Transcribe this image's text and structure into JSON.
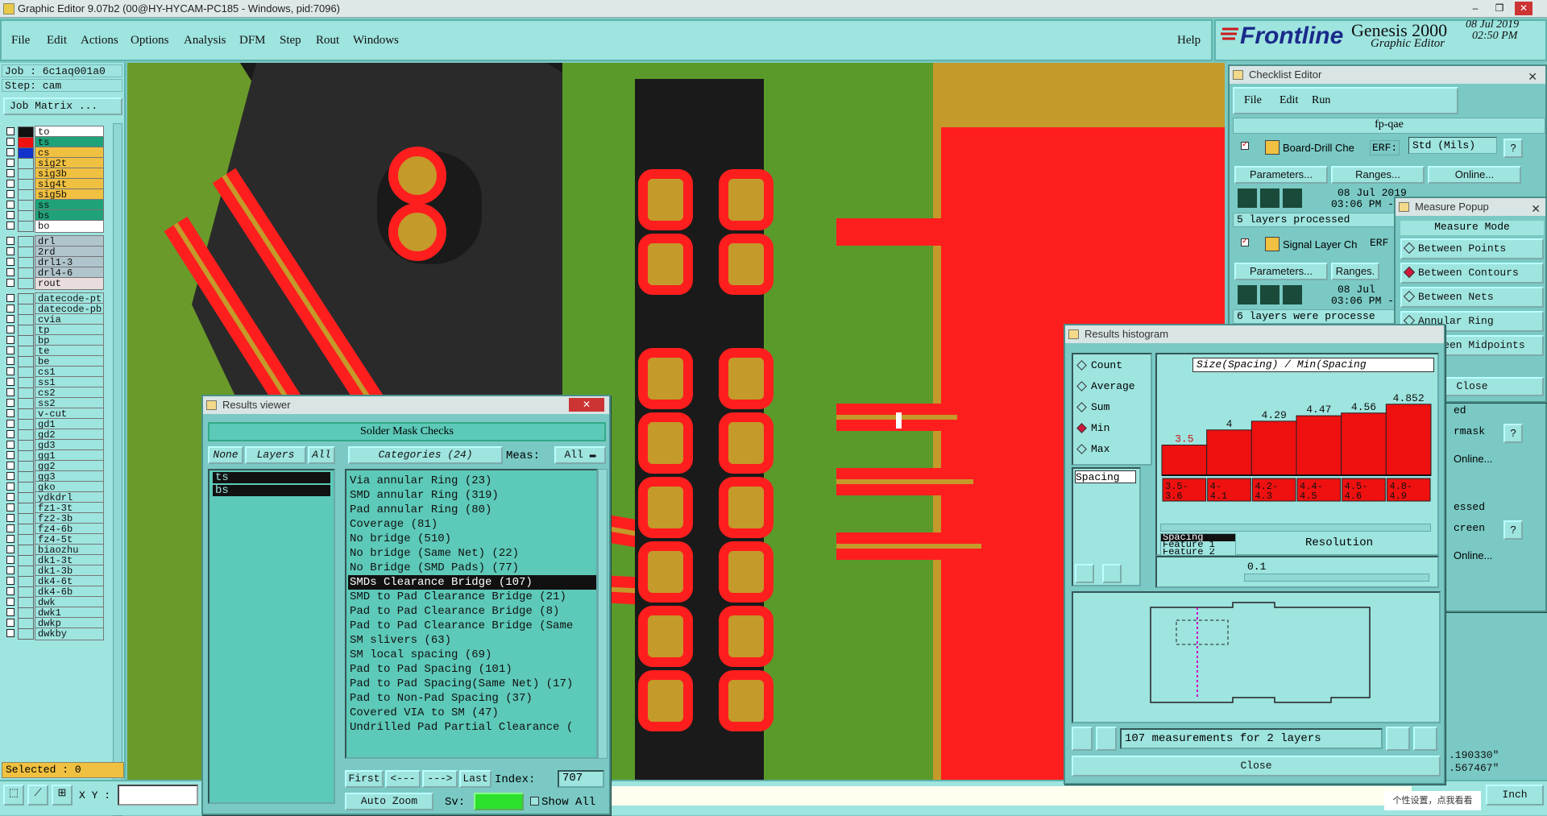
{
  "window_title": "Graphic Editor 9.07b2 (00@HY-HYCAM-PC185 - Windows, pid:7096)",
  "menu": [
    "File",
    "Edit",
    "Actions",
    "Options",
    "Analysis",
    "DFM",
    "Step",
    "Rout",
    "Windows"
  ],
  "help": "Help",
  "brand": {
    "logo": "Frontline",
    "product": "Genesis 2000",
    "subtitle": "Graphic Editor",
    "date": "08 Jul 2019",
    "time": "02:50 PM"
  },
  "job": {
    "job_line": "Job : 6c1aq001a0",
    "step_line": "Step: cam",
    "job_matrix": "Job Matrix ..."
  },
  "layers": [
    {
      "name": "to",
      "color": "#ffffff",
      "swatch": "#111111"
    },
    {
      "name": "ts",
      "color": "#1fa27a",
      "swatch": "#ee1111"
    },
    {
      "name": "cs",
      "color": "#f0c040",
      "swatch": "#1133cc"
    },
    {
      "name": "sig2t",
      "color": "#f0c040",
      "swatch": ""
    },
    {
      "name": "sig3b",
      "color": "#f0c040",
      "swatch": ""
    },
    {
      "name": "sig4t",
      "color": "#f0c040",
      "swatch": ""
    },
    {
      "name": "sig5b",
      "color": "#f0c040",
      "swatch": ""
    },
    {
      "name": "ss",
      "color": "#1fa27a",
      "swatch": ""
    },
    {
      "name": "bs",
      "color": "#1fa27a",
      "swatch": ""
    },
    {
      "name": "bo",
      "color": "#ffffff",
      "swatch": ""
    },
    {
      "name": "drl",
      "color": "#b0c4cc",
      "swatch": ""
    },
    {
      "name": "2rd",
      "color": "#b0c4cc",
      "swatch": ""
    },
    {
      "name": "drl1-3",
      "color": "#b0c4cc",
      "swatch": ""
    },
    {
      "name": "drl4-6",
      "color": "#b0c4cc",
      "swatch": ""
    },
    {
      "name": "rout",
      "color": "#e8dcdc",
      "swatch": ""
    },
    {
      "name": "datecode-pt",
      "color": "#9ee4df",
      "swatch": ""
    },
    {
      "name": "datecode-pb",
      "color": "#9ee4df",
      "swatch": ""
    },
    {
      "name": "cvia",
      "color": "#9ee4df",
      "swatch": ""
    },
    {
      "name": "tp",
      "color": "#9ee4df",
      "swatch": ""
    },
    {
      "name": "bp",
      "color": "#9ee4df",
      "swatch": ""
    },
    {
      "name": "te",
      "color": "#9ee4df",
      "swatch": ""
    },
    {
      "name": "be",
      "color": "#9ee4df",
      "swatch": ""
    },
    {
      "name": "cs1",
      "color": "#9ee4df",
      "swatch": ""
    },
    {
      "name": "ss1",
      "color": "#9ee4df",
      "swatch": ""
    },
    {
      "name": "cs2",
      "color": "#9ee4df",
      "swatch": ""
    },
    {
      "name": "ss2",
      "color": "#9ee4df",
      "swatch": ""
    },
    {
      "name": "v-cut",
      "color": "#9ee4df",
      "swatch": ""
    },
    {
      "name": "gd1",
      "color": "#9ee4df",
      "swatch": ""
    },
    {
      "name": "gd2",
      "color": "#9ee4df",
      "swatch": ""
    },
    {
      "name": "gd3",
      "color": "#9ee4df",
      "swatch": ""
    },
    {
      "name": "gg1",
      "color": "#9ee4df",
      "swatch": ""
    },
    {
      "name": "gg2",
      "color": "#9ee4df",
      "swatch": ""
    },
    {
      "name": "gg3",
      "color": "#9ee4df",
      "swatch": ""
    },
    {
      "name": "gko",
      "color": "#9ee4df",
      "swatch": ""
    },
    {
      "name": "ydkdrl",
      "color": "#9ee4df",
      "swatch": ""
    },
    {
      "name": "fz1-3t",
      "color": "#9ee4df",
      "swatch": ""
    },
    {
      "name": "fz2-3b",
      "color": "#9ee4df",
      "swatch": ""
    },
    {
      "name": "fz4-6b",
      "color": "#9ee4df",
      "swatch": ""
    },
    {
      "name": "fz4-5t",
      "color": "#9ee4df",
      "swatch": ""
    },
    {
      "name": "biaozhu",
      "color": "#9ee4df",
      "swatch": ""
    },
    {
      "name": "dk1-3t",
      "color": "#9ee4df",
      "swatch": ""
    },
    {
      "name": "dk1-3b",
      "color": "#9ee4df",
      "swatch": ""
    },
    {
      "name": "dk4-6t",
      "color": "#9ee4df",
      "swatch": ""
    },
    {
      "name": "dk4-6b",
      "color": "#9ee4df",
      "swatch": ""
    },
    {
      "name": "dwk",
      "color": "#9ee4df",
      "swatch": ""
    },
    {
      "name": "dwk1",
      "color": "#9ee4df",
      "swatch": ""
    },
    {
      "name": "dwkp",
      "color": "#9ee4df",
      "swatch": ""
    },
    {
      "name": "dwkby",
      "color": "#9ee4df",
      "swatch": ""
    }
  ],
  "selected": "Selected : 0",
  "xy_label": "X Y :",
  "units": "Inch",
  "ime_hint": "个性设置，点我看看",
  "coords": {
    "x": ".190330\"",
    "y": ".567467\""
  },
  "results_viewer": {
    "title": "Results viewer",
    "header": "Solder Mask Checks",
    "none": "None",
    "layers": "Layers",
    "all": "All",
    "categories": "Categories (24)",
    "meas_label": "Meas:",
    "meas_value": "All",
    "layer_list": [
      "ts",
      "bs"
    ],
    "items": [
      "Via annular Ring (23)",
      "SMD annular Ring (319)",
      "Pad annular Ring (80)",
      "Coverage (81)",
      "No bridge (510)",
      "No bridge (Same Net) (22)",
      "No Bridge (SMD Pads) (77)",
      "SMDs Clearance Bridge (107)",
      "SMD to Pad Clearance Bridge (21)",
      "Pad to Pad Clearance Bridge (8)",
      "Pad to Pad Clearance Bridge (Same",
      "SM slivers (63)",
      "SM local spacing (69)",
      "Pad to Pad Spacing (101)",
      "Pad to Pad Spacing(Same Net) (17)",
      "Pad to Non-Pad Spacing (37)",
      "Covered VIA to SM (47)",
      "Undrilled Pad Partial Clearance ("
    ],
    "selected_index": 7,
    "first": "First",
    "prev": "<---",
    "next": "--->",
    "last": "Last",
    "index_label": "Index:",
    "index_value": "707",
    "auto_zoom": "Auto Zoom",
    "sv_label": "Sv:",
    "show_all": "Show All"
  },
  "checklist": {
    "title": "Checklist Editor",
    "menu": [
      "File",
      "Edit",
      "Run"
    ],
    "name": "fp-qae",
    "checks": [
      {
        "name": "Board-Drill Che",
        "erf": "ERF:",
        "erf_value": "Std (Mils)",
        "params": "Parameters...",
        "ranges": "Ranges...",
        "online": "Online...",
        "date": "08 Jul 2019",
        "time": "03:06 PM -",
        "status": "5 layers processed"
      },
      {
        "name": "Signal Layer Ch",
        "erf": "ERF",
        "erf_value": "",
        "params": "Parameters...",
        "ranges": "Ranges.",
        "online": "",
        "date": "08 Jul",
        "time": "03:06 PM -",
        "status": "6 layers were processe"
      }
    ],
    "partial": [
      "ed",
      "rmask",
      "Online...",
      "essed",
      "creen",
      "Online..."
    ]
  },
  "measure": {
    "title": "Measure Popup",
    "header": "Measure Mode",
    "modes": [
      "Between Points",
      "Between Contours",
      "Between Nets",
      "Annular Ring",
      "Between Midpoints"
    ],
    "selected_mode": 1,
    "close": "Close"
  },
  "histogram": {
    "title": "Results histogram",
    "stats": [
      "Count",
      "Average",
      "Sum",
      "Min",
      "Max"
    ],
    "selected_stat": 3,
    "field": "Spacing",
    "chart_title": "Size(Spacing) / Min(Spacing",
    "ranges": [
      "Spacing",
      "Feature 1",
      "Feature 2"
    ],
    "resolution_label": "Resolution",
    "resolution_value": "0.1",
    "summary": "107 measurements for 2 layers",
    "close": "Close",
    "chart_data": {
      "type": "bar",
      "categories": [
        "3.5-3.6",
        "4-4.1",
        "4.2-4.3",
        "4.4-4.5",
        "4.5-4.6",
        "4.8-4.9"
      ],
      "values": [
        3.5,
        4,
        4.29,
        4.47,
        4.56,
        4.852
      ],
      "labels": [
        "3.5",
        "4",
        "4.29",
        "4.47",
        "4.56",
        "4.852"
      ],
      "ylim": [
        2.5,
        4.9
      ]
    }
  }
}
